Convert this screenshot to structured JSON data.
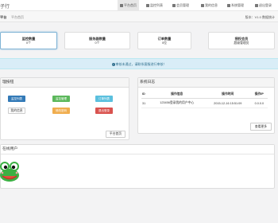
{
  "header": {
    "brand": "子行",
    "nav": [
      {
        "label": "平台首页",
        "icon": "home-icon",
        "active": true
      },
      {
        "label": "监控列表",
        "icon": "list-icon",
        "active": false
      },
      {
        "label": "会员管理",
        "icon": "users-icon",
        "active": false
      },
      {
        "label": "我的信息",
        "icon": "user-icon",
        "active": false
      },
      {
        "label": "系统管理",
        "icon": "gear-icon",
        "active": false
      },
      {
        "label": "退出登录",
        "icon": "logout-icon",
        "active": false
      }
    ]
  },
  "breadcrumb": {
    "home": "平台",
    "current": "平台首页",
    "version": "版本：V1.0 数据统计"
  },
  "stats": [
    {
      "label": "监控数量",
      "value": "0个"
    },
    {
      "label": "服务器数量",
      "value": "0个"
    },
    {
      "label": "订单数量",
      "value": "0位"
    },
    {
      "label": "授权会员",
      "value": "超级管理员"
    }
  ],
  "notice": "审核未通过，请联系客服进行审核！",
  "quick_panel": {
    "title": "理按钮",
    "buttons": [
      {
        "label": "监控列表",
        "color": "#337ab7"
      },
      {
        "label": "监控管理",
        "color": "#5cb85c"
      },
      {
        "label": "订单列表",
        "color": "#5bc0de"
      },
      {
        "label": "我的信息",
        "color": "#ffffff"
      },
      {
        "label": "修改密码",
        "color": "#f0ad4e"
      },
      {
        "label": "退出登录",
        "color": "#d9534f"
      }
    ],
    "footer_button": "平台首页"
  },
  "log_panel": {
    "title": "系统日志",
    "columns": [
      "ID",
      "操作信息",
      "操作时间",
      "操作IP"
    ],
    "rows": [
      [
        "31",
        "123456登录我的用户中心",
        "2015-12-16 15:51:09",
        "0.0.0.0"
      ]
    ],
    "footer_button": "查看更多"
  },
  "users_panel": {
    "title": "在线用户"
  }
}
